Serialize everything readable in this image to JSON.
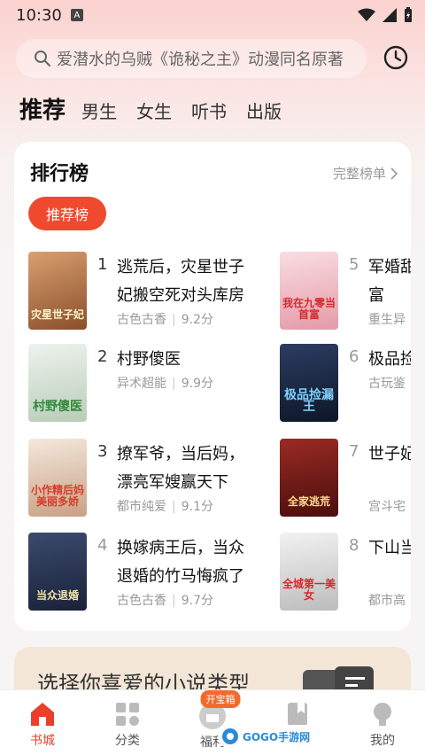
{
  "status": {
    "time": "10:30",
    "badge": "A"
  },
  "search": {
    "placeholder": "爱潜水的乌贼《诡秘之主》动漫同名原著"
  },
  "tabs": [
    "推荐",
    "男生",
    "女生",
    "听书",
    "出版"
  ],
  "ranking": {
    "title": "排行榜",
    "more": "完整榜单",
    "pill": "推荐榜",
    "books": [
      {
        "rank": "1",
        "title": "逃荒后，灾星世子妃搬空死对头库房",
        "genre": "古色古香",
        "score": "9.2分",
        "cover_text": "灾星世子妃",
        "cover_color": "#c98a5a"
      },
      {
        "rank": "2",
        "title": "村野傻医",
        "genre": "异术超能",
        "score": "9.9分",
        "cover_text": "村野傻医",
        "cover_color": "#d6e0d8"
      },
      {
        "rank": "3",
        "title": "撩军爷，当后妈，漂亮军嫂赢天下",
        "genre": "都市纯爱",
        "score": "9.1分",
        "cover_text": "小作精后妈美丽多娇",
        "cover_color": "#e8d8c8"
      },
      {
        "rank": "4",
        "title": "换嫁病王后，当众退婚的竹马悔疯了",
        "genre": "古色古香",
        "score": "9.7分",
        "cover_text": "当众退婚",
        "cover_color": "#2d3a5a"
      },
      {
        "rank": "5",
        "title": "军婚甜宠九零当首富",
        "genre": "重生异",
        "score": "",
        "cover_text": "我在九零当首富",
        "cover_color": "#f2c8cf"
      },
      {
        "rank": "6",
        "title": "极品捡漏王",
        "genre": "古玩鉴",
        "score": "",
        "cover_text": "极品捡漏王",
        "cover_color": "#1c2a44"
      },
      {
        "rank": "7",
        "title": "世子妃全家逃荒",
        "genre": "宫斗宅",
        "score": "",
        "cover_text": "全家逃荒",
        "cover_color": "#7a1f1f"
      },
      {
        "rank": "8",
        "title": "下山当一美女",
        "genre": "都市高",
        "score": "",
        "cover_text": "全城第一美女",
        "cover_color": "#e5e5e5"
      }
    ]
  },
  "genre_banner": {
    "text": "选择你喜爱的小说类型"
  },
  "nav": {
    "items": [
      "书城",
      "分类",
      "福利",
      "书架",
      "我的"
    ],
    "badge": "开宝箱"
  },
  "watermark": {
    "text": "GOGO手游网"
  },
  "colors": {
    "accent": "#f04a2e",
    "nav_active": "#e8402a"
  }
}
